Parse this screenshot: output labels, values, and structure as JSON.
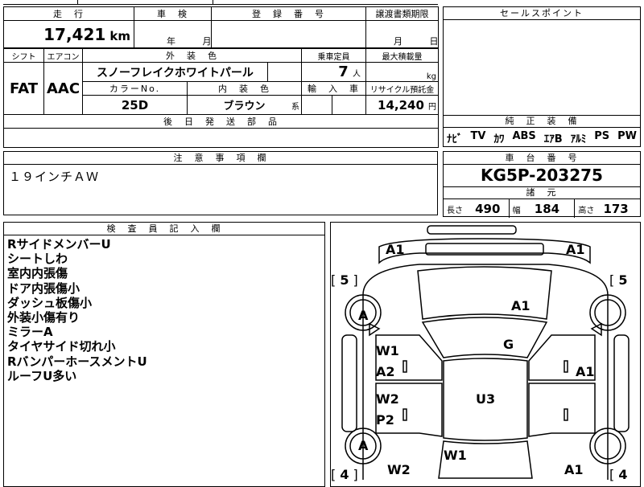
{
  "top": {
    "mileage_header": "走　行",
    "mileage_value": "17,421",
    "mileage_unit": "km",
    "inspection_header": "車　検",
    "inspection_year": "年",
    "inspection_month": "月",
    "registration_header": "登　録　番　号",
    "transfer_header": "譲渡書類期限",
    "transfer_month": "月",
    "transfer_day": "日",
    "sales_point_header": "セールスポイント"
  },
  "spec": {
    "shift_header": "シフト",
    "aircon_header": "エアコン",
    "shift_value": "FAT",
    "aircon_value": "AAC",
    "ext_color_header": "外　装　色",
    "ext_color_value": "スノーフレイクホワイトパール",
    "capacity_header": "乗車定員",
    "capacity_value": "7",
    "capacity_unit": "人",
    "max_load_header": "最大積載量",
    "max_load_unit": "kg",
    "color_no_header": "カラーNo.",
    "color_no_value": "25D",
    "int_color_header": "内　装　色",
    "int_color_value": "ブラウン",
    "int_color_suffix": "系",
    "import_header": "輸　入　車",
    "recycle_header": "リサイクル預託金",
    "recycle_value": "14,240",
    "recycle_unit": "円",
    "later_parts_header": "後　日　発　送　部　品",
    "equipment_header": "純　正　装　備",
    "equipment_items": [
      "ﾅﾋﾞ",
      "TV",
      "ｶﾜ",
      "ABS",
      "ｴｱB",
      "ｱﾙﾐ",
      "PS",
      "PW"
    ]
  },
  "notes": {
    "header": "注　意　事　項　欄",
    "text": "１９インチＡＷ"
  },
  "chassis": {
    "header": "車　台　番　号",
    "value": "KG5P-203275",
    "dims_header": "諸　元",
    "length_label": "長さ",
    "length_value": "490",
    "width_label": "幅",
    "width_value": "184",
    "height_label": "高さ",
    "height_value": "173"
  },
  "inspector": {
    "header": "検　査　員　記　入　欄",
    "lines": [
      "RサイドメンバーU",
      "シートしわ",
      "室内内張傷",
      "ドア内張傷小",
      "ダッシュ板傷小",
      "外装小傷有り",
      "ミラーA",
      "タイヤサイド切れ小",
      "RバンパーホースメントU",
      "ルーフU多い"
    ]
  },
  "diagram": {
    "marks": {
      "front_left": "A1",
      "front_right": "A1",
      "tire_fl": "5",
      "tire_fr": "5",
      "tire_rl": "4",
      "tire_rr": "4",
      "wheel_fl": "A",
      "wheel_rl": "A",
      "hood": "A1",
      "windshield": "G",
      "door_fl_w": "W1",
      "door_fl_a": "A2",
      "door_rl_w": "W2",
      "door_rl_p": "P2",
      "door_fr": "A1",
      "roof": "U3",
      "rear_glass": "W1",
      "rear_left": "W2",
      "rear_right": "A1"
    }
  }
}
